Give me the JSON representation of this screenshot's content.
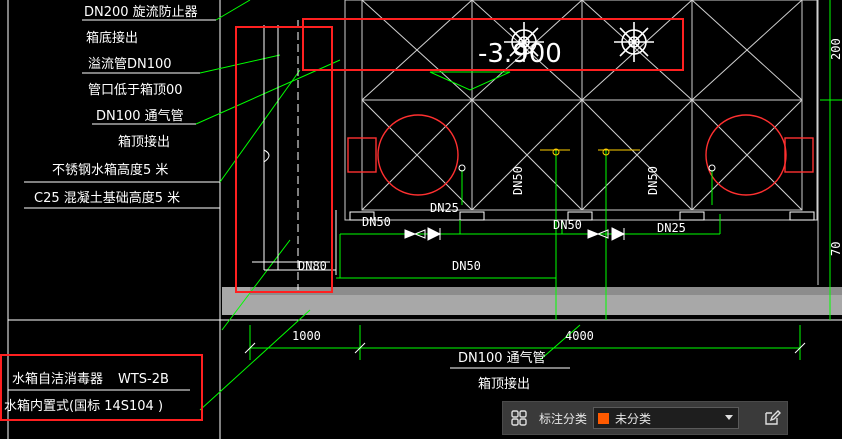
{
  "drawing": {
    "labels_left": [
      "DN200  旋流防止器",
      "箱底接出",
      "溢流管DN100",
      "管口低于箱顶00",
      "DN100   通气管",
      "箱顶接出",
      "不锈钢水箱高度5  米",
      "C25  混凝土基础高度5  米"
    ],
    "elevation": "-3.900",
    "pipe_labels": {
      "dn50_a": "DN50",
      "dn25_a": "DN25",
      "dn50_vert_a": "DN50",
      "dn50_b": "DN50",
      "dn25_b": "DN25",
      "dn50_vert_b": "DN50",
      "dn80": "DN80",
      "dn50_c": "DN50"
    },
    "dimensions": {
      "d1000": "1000",
      "d4000": "4000",
      "right_top": "200",
      "right_mid": "70"
    },
    "bottom_labels": {
      "vent_pipe": "DN100   通气管",
      "vent_from_top": "箱顶接出"
    },
    "legend": {
      "line1_name": "水箱自洁消毒器",
      "line1_model": "WTS-2B",
      "line2": "水箱内置式(国标     14S104     )"
    },
    "colors": {
      "highlight": "#ff2020",
      "cad_line": "#ffffff",
      "pipe": "#00ff00",
      "slab": "#a8a8a8",
      "tank_grid": "#d0d0d0",
      "leader": "#00ff00"
    }
  },
  "toolbar": {
    "category_label": "标注分类",
    "selected_category": "未分类",
    "swatch_color": "#ff5a00"
  }
}
